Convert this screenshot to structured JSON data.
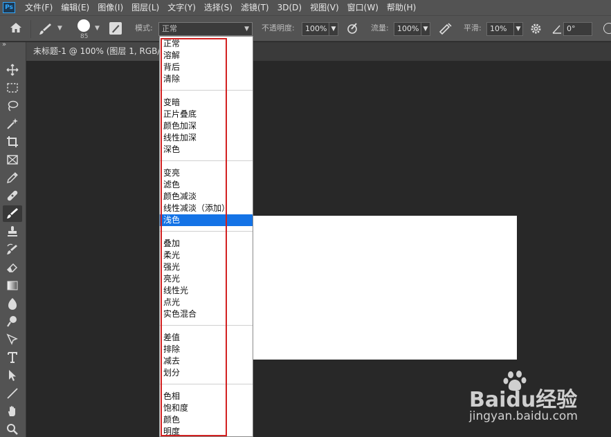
{
  "app": {
    "logo_text": "Ps",
    "menu": [
      "文件(F)",
      "编辑(E)",
      "图像(I)",
      "图层(L)",
      "文字(Y)",
      "选择(S)",
      "滤镜(T)",
      "3D(D)",
      "视图(V)",
      "窗口(W)",
      "帮助(H)"
    ]
  },
  "options_bar": {
    "brush_size": "85",
    "mode_label": "模式:",
    "mode_value": "正常",
    "opacity_label": "不透明度:",
    "opacity_value": "100%",
    "flow_label": "流量:",
    "flow_value": "100%",
    "smoothing_label": "平滑:",
    "smoothing_value": "10%",
    "angle_value": "0°"
  },
  "document": {
    "tab_title": "未标题-1 @ 100% (图层 1, RGB/8#"
  },
  "blend_modes": {
    "groups": [
      [
        "正常",
        "溶解",
        "背后",
        "清除"
      ],
      [
        "变暗",
        "正片叠底",
        "颜色加深",
        "线性加深",
        "深色"
      ],
      [
        "变亮",
        "滤色",
        "颜色减淡",
        "线性减淡（添加）",
        "浅色"
      ],
      [
        "叠加",
        "柔光",
        "强光",
        "亮光",
        "线性光",
        "点光",
        "实色混合"
      ],
      [
        "差值",
        "排除",
        "减去",
        "划分"
      ],
      [
        "色相",
        "饱和度",
        "颜色",
        "明度"
      ]
    ],
    "selected": "浅色"
  },
  "watermark": {
    "brand": "Baidu经验",
    "url": "jingyan.baidu.com"
  },
  "colors": {
    "chrome": "#535353",
    "canvas_bg": "#282828",
    "selection": "#1473e6",
    "highlight_box": "#d21f1f"
  }
}
